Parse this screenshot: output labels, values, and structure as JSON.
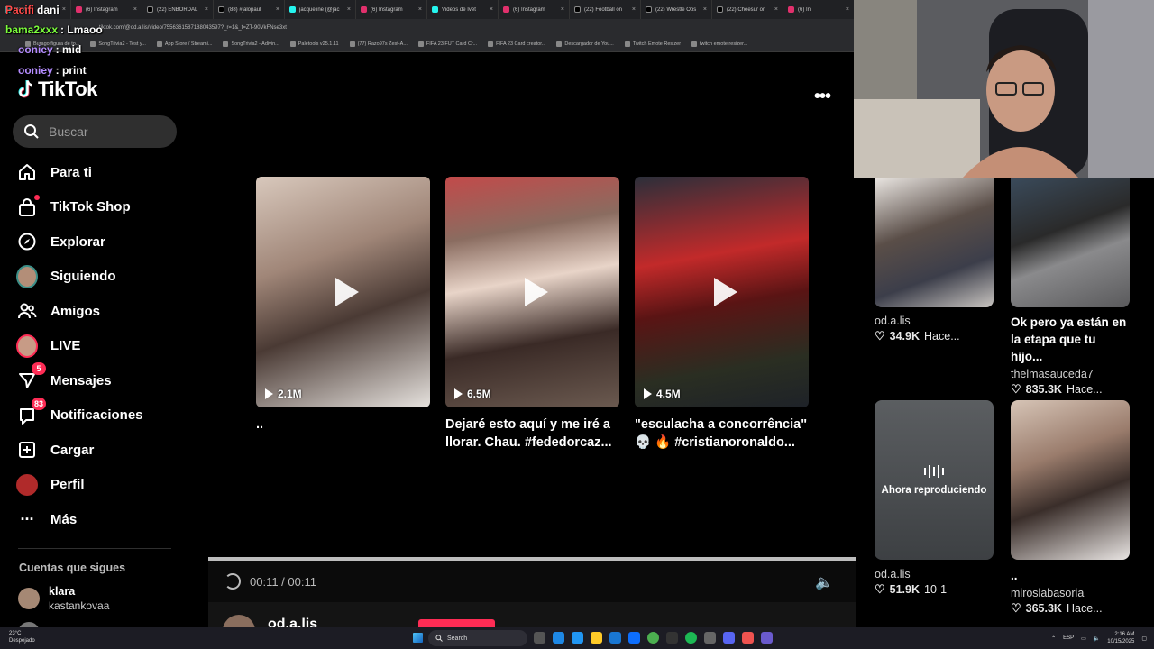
{
  "browser": {
    "tabs": [
      {
        "label": "Pacifi",
        "icon": "tiktok"
      },
      {
        "label": "(6) Instagram",
        "icon": "instagram"
      },
      {
        "label": "(22) ENBORDAL",
        "icon": "x"
      },
      {
        "label": "(88) #jalopaul",
        "icon": "x"
      },
      {
        "label": "jacqueline (@jac",
        "icon": "tiktok"
      },
      {
        "label": "(6) Instagram",
        "icon": "instagram"
      },
      {
        "label": "Videos de Ivet",
        "icon": "tiktok"
      },
      {
        "label": "(6) Instagram",
        "icon": "instagram"
      },
      {
        "label": "(22) Football on",
        "icon": "x"
      },
      {
        "label": "(22) Wrestle Ops",
        "icon": "x"
      },
      {
        "label": "(22) Cheesur on",
        "icon": "x"
      },
      {
        "label": "(6) In",
        "icon": "instagram"
      }
    ],
    "url": "tiktok.com/@od.a.lis/video/7556361587188043597?_r=1&_t=ZT-90VkFNse3xt",
    "bookmarks": [
      "Burago figura de to...",
      "SongTrivia2 - Test y...",
      "App Store / Streami...",
      "SongTrivia2 - Adivin...",
      "Paletools v25.1.11",
      "(77) Razo97s Zest-A...",
      "FIFA 23 FUT Card Cr...",
      "FIFA 23 Card creator...",
      "Descargador de You...",
      "Twitch Emote Resizer",
      "twitch emote resizer..."
    ]
  },
  "chat": [
    {
      "user": "Pacifi",
      "msg": "dani",
      "color": "#ff4a4a"
    },
    {
      "user": "bama2xxx",
      "msg": ": Lmaoo",
      "color": "#7cff3c"
    },
    {
      "user": "ooniey",
      "msg": ": mid",
      "color": "#b58cff"
    },
    {
      "user": "ooniey",
      "msg": ": print",
      "color": "#b58cff"
    }
  ],
  "sidebar": {
    "logo": "TikTok",
    "search_placeholder": "Buscar",
    "nav": [
      {
        "label": "Para ti",
        "icon": "home-icon",
        "badge": ""
      },
      {
        "label": "TikTok Shop",
        "icon": "shop-icon",
        "badge": ""
      },
      {
        "label": "Explorar",
        "icon": "compass-icon",
        "badge": ""
      },
      {
        "label": "Siguiendo",
        "icon": "following-avatar-icon",
        "badge": ""
      },
      {
        "label": "Amigos",
        "icon": "friends-icon",
        "badge": ""
      },
      {
        "label": "LIVE",
        "icon": "live-avatar-icon",
        "badge": ""
      },
      {
        "label": "Mensajes",
        "icon": "messages-icon",
        "badge": "5"
      },
      {
        "label": "Notificaciones",
        "icon": "notifications-icon",
        "badge": "83"
      },
      {
        "label": "Cargar",
        "icon": "upload-icon",
        "badge": ""
      },
      {
        "label": "Perfil",
        "icon": "profile-avatar-icon",
        "badge": ""
      },
      {
        "label": "Más",
        "icon": "more-icon",
        "badge": ""
      }
    ],
    "following_title": "Cuentas que sigues",
    "following": [
      {
        "name": "klara",
        "username": "kastankovaa"
      }
    ]
  },
  "main": {
    "videos": [
      {
        "views": "2.1M",
        "caption": ".."
      },
      {
        "views": "6.5M",
        "caption": "Dejaré esto aquí y me iré a llorar. Chau. #fededorcaz..."
      },
      {
        "views": "4.5M",
        "caption": "\"esculacha a concorrência\" 💀 🔥 #cristianoronaldo..."
      }
    ],
    "player": {
      "time": "00:11 / 00:11",
      "progress": 1.0
    },
    "author": "od.a.lis"
  },
  "related": [
    {
      "author": "od.a.lis",
      "likes": "34.9K",
      "date": "Hace...",
      "title": ""
    },
    {
      "author": "thelmasauceda7",
      "likes": "835.3K",
      "date": "Hace...",
      "title": "Ok pero ya están en la etapa que tu hijo..."
    },
    {
      "author": "od.a.lis",
      "likes": "51.9K",
      "date": "10-1",
      "title": "",
      "overlay": "Ahora reproduciendo"
    },
    {
      "author": "miroslabasoria",
      "likes": "365.3K",
      "date": "Hace...",
      "title": ".."
    }
  ],
  "taskbar": {
    "weather_temp": "23°C",
    "weather_desc": "Despejado",
    "search": "Search",
    "lang": "ESP",
    "time": "2:16 AM",
    "date": "10/15/2025"
  },
  "colors": {
    "accent": "#fe2c55",
    "bg": "#000000",
    "surface": "#2f2f2f"
  }
}
